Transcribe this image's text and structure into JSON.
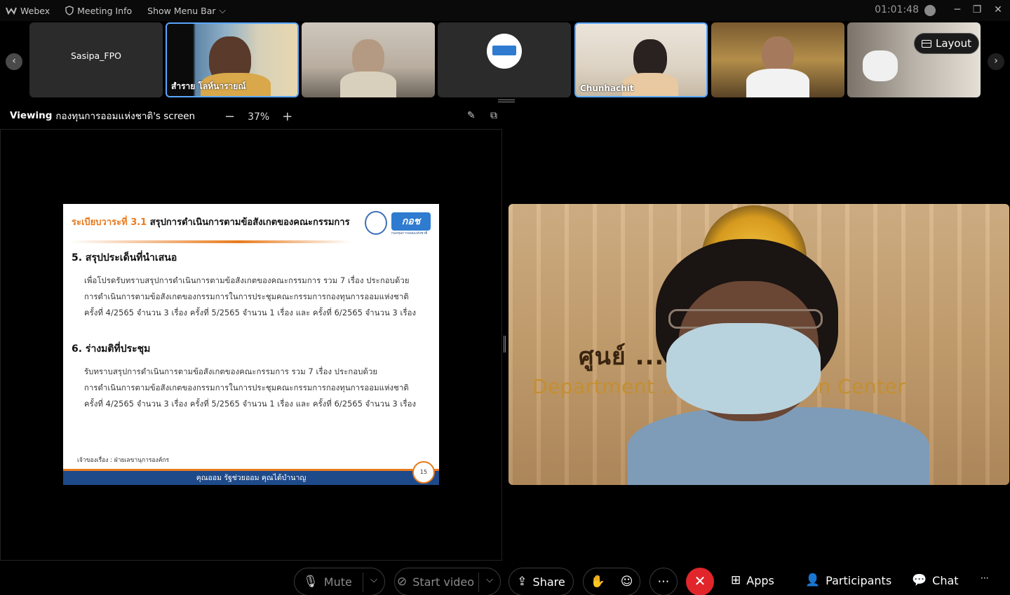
{
  "titlebar": {
    "app_name": "Webex",
    "meeting_info": "Meeting Info",
    "show_menu_bar": "Show Menu Bar",
    "timer": "01:01:48"
  },
  "participants": [
    {
      "name": "Sasipa_FPO",
      "active": false
    },
    {
      "name": "สำราย โลห์นารายณ์",
      "active": true
    },
    {
      "name": "",
      "active": false
    },
    {
      "name": "",
      "active": false
    },
    {
      "name": "Chunhachit",
      "active": true
    },
    {
      "name": "",
      "active": false
    },
    {
      "name": "",
      "active": false
    }
  ],
  "layout_label": "Layout",
  "viewing": {
    "prefix": "Viewing",
    "owner": "กองทุนการออมแห่งชาติ's screen",
    "zoom": "37%"
  },
  "slide": {
    "header_prefix": "ระเบียบวาระที่ 3.1",
    "header_title": "สรุปการดำเนินการตามข้อสังเกตของคณะกรรมการ",
    "brand": "กอช",
    "brand_sub": "กองทุนการออมแห่งชาติ",
    "section5_title": "5. สรุปประเด็นที่นำเสนอ",
    "section5_lines": [
      "เพื่อโปรดรับทราบสรุปการดำเนินการตามข้อสังเกตของคณะกรรมการ รวม 7 เรื่อง ประกอบด้วย",
      "การดำเนินการตามข้อสังเกตของกรรมการในการประชุมคณะกรรมการกองทุนการออมแห่งชาติ",
      "ครั้งที่ 4/2565 จำนวน 3 เรื่อง ครั้งที่ 5/2565 จำนวน 1 เรื่อง และ ครั้งที่ 6/2565 จำนวน 3 เรื่อง"
    ],
    "section6_title": "6. ร่างมติที่ประชุม",
    "section6_lines": [
      "รับทราบสรุปการดำเนินการตามข้อสังเกตของคณะกรรมการ รวม 7 เรื่อง ประกอบด้วย",
      "การดำเนินการตามข้อสังเกตของกรรมการในการประชุมคณะกรรมการกองทุนการออมแห่งชาติ",
      "ครั้งที่ 4/2565 จำนวน 3 เรื่อง ครั้งที่ 5/2565 จำนวน 1 เรื่อง และ ครั้งที่ 6/2565 จำนวน 3 เรื่อง"
    ],
    "owner": "เจ้าของเรื่อง : ฝ่ายเลขานุการองค์กร",
    "footer": "คุณออม รัฐช่วยออม คุณได้บำนาญ",
    "page_number": "15"
  },
  "speaker": {
    "sign_thai": "ศูนย์ ... งการผู้สูงอายุ",
    "sign_english": "Department ... ons Operation Center"
  },
  "controls": {
    "mute": "Mute",
    "start_video": "Start video",
    "share": "Share",
    "apps": "Apps",
    "participants": "Participants",
    "chat": "Chat"
  }
}
